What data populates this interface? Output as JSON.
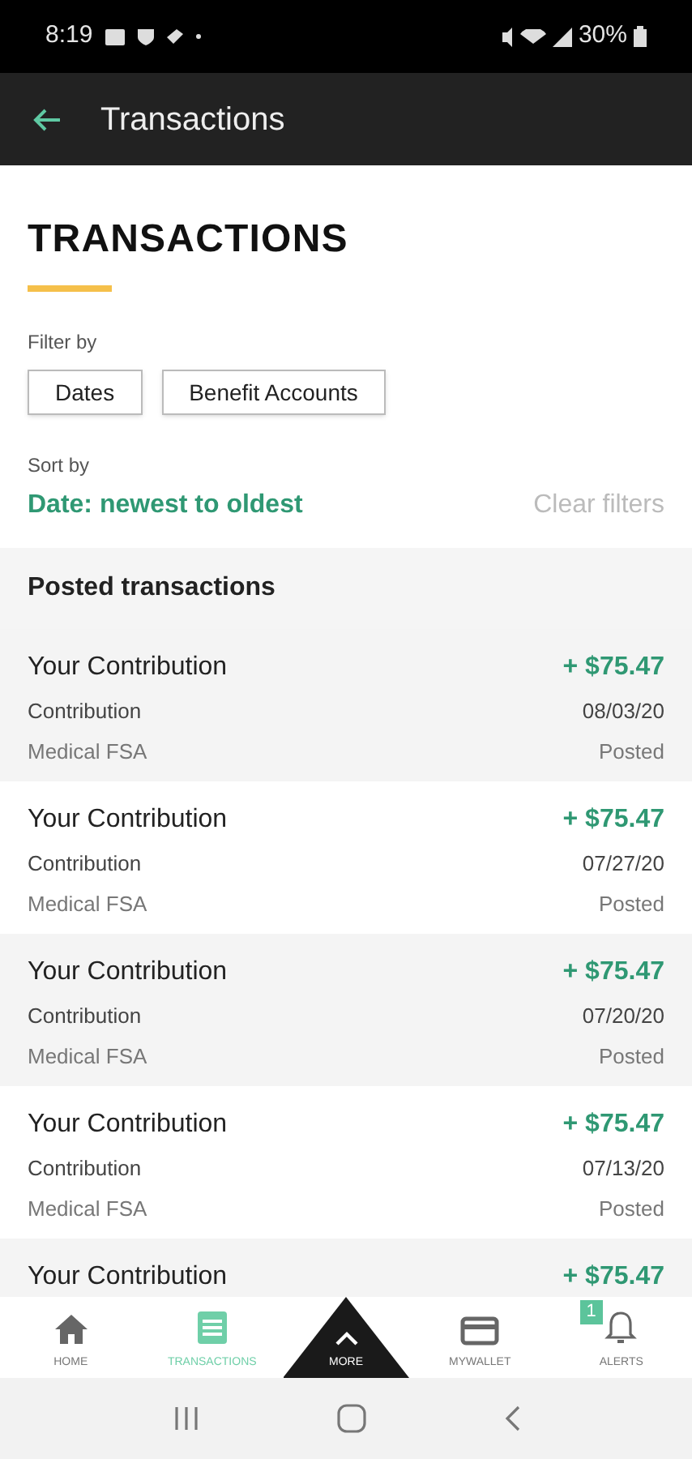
{
  "status_bar": {
    "time": "8:19",
    "battery": "30%"
  },
  "app_bar": {
    "title": "Transactions"
  },
  "page": {
    "heading": "TRANSACTIONS",
    "filter_label": "Filter by",
    "filters": [
      "Dates",
      "Benefit Accounts"
    ],
    "sort_label": "Sort by",
    "sort_value": "Date: newest to oldest",
    "clear": "Clear filters"
  },
  "section_title": "Posted transactions",
  "transactions": [
    {
      "title": "Your Contribution",
      "amount": "+ $75.47",
      "type": "Contribution",
      "date": "08/03/20",
      "account": "Medical FSA",
      "status": "Posted"
    },
    {
      "title": "Your Contribution",
      "amount": "+ $75.47",
      "type": "Contribution",
      "date": "07/27/20",
      "account": "Medical FSA",
      "status": "Posted"
    },
    {
      "title": "Your Contribution",
      "amount": "+ $75.47",
      "type": "Contribution",
      "date": "07/20/20",
      "account": "Medical FSA",
      "status": "Posted"
    },
    {
      "title": "Your Contribution",
      "amount": "+ $75.47",
      "type": "Contribution",
      "date": "07/13/20",
      "account": "Medical FSA",
      "status": "Posted"
    },
    {
      "title": "Your Contribution",
      "amount": "+ $75.47"
    }
  ],
  "bottom_nav": [
    {
      "kind": "home",
      "label": "HOME",
      "selected": false
    },
    {
      "kind": "transactions",
      "label": "TRANSACTIONS",
      "selected": true
    },
    {
      "kind": "more",
      "label": "MORE",
      "selected": false
    },
    {
      "kind": "wallet",
      "label": "MYWALLET",
      "selected": false
    },
    {
      "kind": "alerts",
      "label": "ALERTS",
      "selected": false,
      "badge": "1"
    }
  ]
}
